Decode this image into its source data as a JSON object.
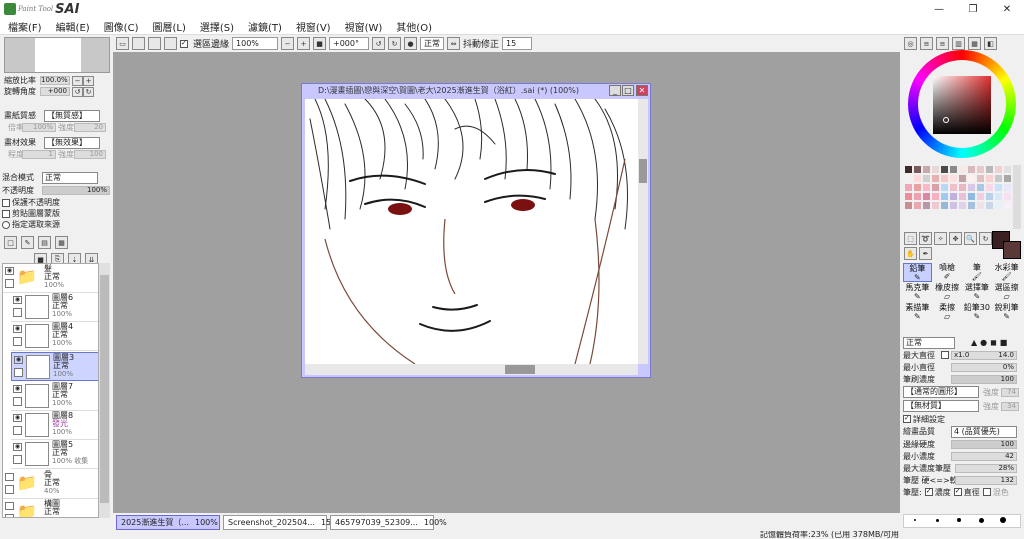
{
  "app": {
    "logo_small": "Paint Tool",
    "logo_big": "SAI"
  },
  "window_controls": {
    "minimize": "—",
    "maximize": "❐",
    "close": "✕"
  },
  "menu": [
    "檔案(F)",
    "編輯(E)",
    "圖像(C)",
    "圖層(L)",
    "選擇(S)",
    "濾鏡(T)",
    "視窗(V)",
    "視窗(W)",
    "其他(O)"
  ],
  "toolbar": {
    "antialias_label": "選區邊緣",
    "zoom": "100%",
    "rotation": "+000°",
    "blend": "正常",
    "stabilizer_label": "抖動修正",
    "stabilizer_value": "15"
  },
  "left_panel": {
    "zoom_label": "縮放比率",
    "zoom_value": "100.0%",
    "angle_label": "旋轉角度",
    "angle_value": "+000",
    "paper_label": "畫紙質感",
    "paper_value": "【無質感】",
    "paper_scale_label": "倍率",
    "paper_scale_value": "100%",
    "paper_strength_label": "強度",
    "paper_strength_value": "20",
    "effect_label": "畫材效果",
    "effect_value": "【無效果】",
    "effect_width_label": "程度",
    "effect_width_value": "1",
    "effect_strength_label": "強度",
    "effect_strength_value": "100",
    "blend_label": "混合模式",
    "blend_value": "正常",
    "opacity_label": "不透明度",
    "opacity_value": "100%",
    "protect_label": "保護不透明度",
    "clip_label": "剪貼圖層蒙版",
    "source_label": "指定選取來源"
  },
  "layers": [
    {
      "name": "髮",
      "mode": "正常",
      "opacity": "100%",
      "folder": true,
      "active": false
    },
    {
      "name": "圖層6",
      "mode": "正常",
      "opacity": "100%",
      "folder": false,
      "active": false
    },
    {
      "name": "圖層4",
      "mode": "正常",
      "opacity": "100%",
      "folder": false,
      "active": false
    },
    {
      "name": "圖層3",
      "mode": "正常",
      "opacity": "100%",
      "folder": false,
      "active": true
    },
    {
      "name": "圖層7",
      "mode": "正常",
      "opacity": "100%",
      "folder": false,
      "active": false
    },
    {
      "name": "圖層8",
      "mode": "發光",
      "opacity": "100%",
      "folder": false,
      "active": false
    },
    {
      "name": "圖層5",
      "mode": "正常",
      "opacity": "100% 收集",
      "folder": false,
      "active": false
    },
    {
      "name": "骨",
      "mode": "正常",
      "opacity": "40%",
      "folder": true,
      "active": false
    },
    {
      "name": "構圖",
      "mode": "正常",
      "opacity": "",
      "folder": true,
      "active": false
    }
  ],
  "document": {
    "title": "D:\\漫畫插圖\\戀與深空\\賀圖\\老大\\2025漸進生賀（浴紅）.sai (*) (100%)",
    "min": "_",
    "max": "□",
    "close": "✕"
  },
  "tabs": [
    {
      "name": "2025漸進生賀（...",
      "zoom": "100%",
      "active": true
    },
    {
      "name": "Screenshot_202504...",
      "zoom": "150%",
      "active": false
    },
    {
      "name": "465797039_52309...",
      "zoom": "100%",
      "active": false
    }
  ],
  "status": "記憶體負荷率:23% (已用 378MB/可用 1208MB)",
  "swatch_colors": [
    "#3a2a2a",
    "#7a5a5a",
    "#c8a8a8",
    "#e8d8d8",
    "#4a4a4a",
    "#8a8a8a",
    "#f8e8e8",
    "#d8b8b8",
    "#e8c8c8",
    "#b8b8b8",
    "#f0d0d0",
    "#e0e0e0",
    "#f0f0f0",
    "#ffd8d8",
    "#d0d0d0",
    "#e8b0b0",
    "#f8c8c8",
    "#ffe0e0",
    "#c0a0a0",
    "#fff0f0",
    "#e0c0c0",
    "#f8d0d0",
    "#c8c8c8",
    "#a8a8a8",
    "#f0a8b8",
    "#e8a0a0",
    "#f8b8c8",
    "#d8a0a8",
    "#b8d8f8",
    "#f0c0c8",
    "#e8b8c0",
    "#d8c8e8",
    "#a8c8e8",
    "#f8d8e8",
    "#c8e0f8",
    "#e8e8f8",
    "#e89098",
    "#f0a0b0",
    "#d888a0",
    "#f8b0c0",
    "#a0c8f0",
    "#c0b0e0",
    "#e8c0d8",
    "#90b8e0",
    "#f0d0e0",
    "#b8d0e8",
    "#d8e8f8",
    "#f8e0f0",
    "#c89090",
    "#e8a8b0",
    "#b898a8",
    "#f0c8d0",
    "#98b8d8",
    "#d0c0e8",
    "#e0d0e8",
    "#a8c0e0",
    "#f0e0e8",
    "#c8d8e8",
    "#e8f0f8",
    "#f8f0f8"
  ],
  "fg_color": "#3a2020",
  "tools": [
    "鉛筆",
    "噴槍",
    "筆",
    "水彩筆",
    "馬克筆",
    "橡皮擦",
    "選擇筆",
    "選區擦",
    "素描筆",
    "柔擦",
    "鉛筆30",
    "銳利筆"
  ],
  "brush": {
    "mode": "正常",
    "max_size_label": "最大直徑",
    "max_size_x": "x1.0",
    "max_size_value": "14.0",
    "min_size_label": "最小直徑",
    "min_size_value": "0%",
    "density_label": "筆刷濃度",
    "density_value": "100",
    "shape_value": "【通常的圓形】",
    "shape_strength_label": "強度",
    "shape_strength_value": "74",
    "texture_value": "【無材質】",
    "texture_strength_label": "強度",
    "texture_strength_value": "34",
    "detail_label": "詳細設定",
    "quality_label": "繪畫品質",
    "quality_value": "4 (品質優先)",
    "hardness_label": "邊緣硬度",
    "hardness_value": "100",
    "min_density_label": "最小濃度",
    "min_density_value": "42",
    "max_pressure_label": "最大濃度筆壓",
    "max_pressure_value": "28%",
    "pressure_label": "筆壓 硬<=>軟",
    "pressure_value": "132",
    "pressure_opt_label": "筆壓:",
    "opt_density": "濃度",
    "opt_size": "直徑",
    "opt_blend": "混色"
  }
}
